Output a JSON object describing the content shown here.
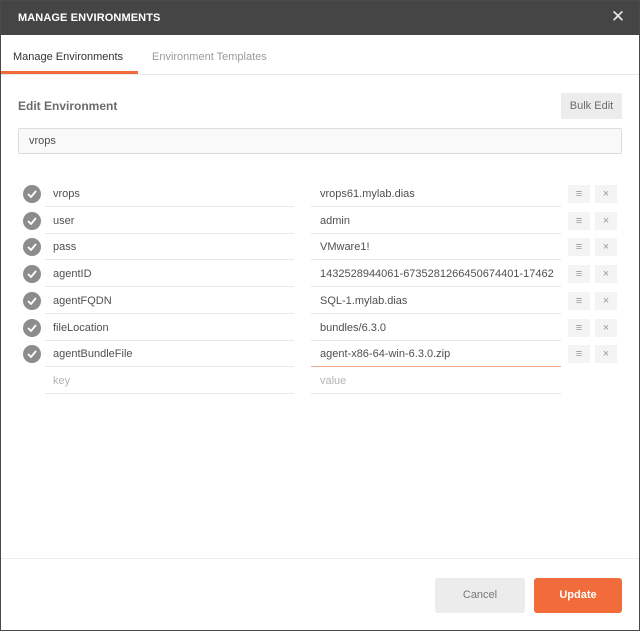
{
  "window": {
    "title": "MANAGE ENVIRONMENTS",
    "close_icon": "close-icon"
  },
  "tabs": [
    {
      "label": "Manage Environments",
      "active": true
    },
    {
      "label": "Environment Templates",
      "active": false
    }
  ],
  "editor": {
    "section_title": "Edit Environment",
    "bulk_edit_label": "Bulk Edit",
    "environment_name": "vrops"
  },
  "variables": [
    {
      "key": "vrops",
      "value": "vrops61.mylab.dias",
      "enabled": true
    },
    {
      "key": "user",
      "value": "admin",
      "enabled": true
    },
    {
      "key": "pass",
      "value": "VMware1!",
      "enabled": true
    },
    {
      "key": "agentID",
      "value": "1432528944061-6735281266450674401-17462",
      "enabled": true
    },
    {
      "key": "agentFQDN",
      "value": "SQL-1.mylab.dias",
      "enabled": true
    },
    {
      "key": "fileLocation",
      "value": "bundles/6.3.0",
      "enabled": true
    },
    {
      "key": "agentBundleFile",
      "value": "agent-x86-64-win-6.3.0.zip",
      "enabled": true
    }
  ],
  "new_row": {
    "key_placeholder": "key",
    "value_placeholder": "value"
  },
  "icons": {
    "row_menu": "≡",
    "row_remove": "×",
    "close": "✕"
  },
  "footer": {
    "cancel_label": "Cancel",
    "update_label": "Update"
  },
  "colors": {
    "accent": "#f26b3a",
    "titlebar": "#454545"
  }
}
